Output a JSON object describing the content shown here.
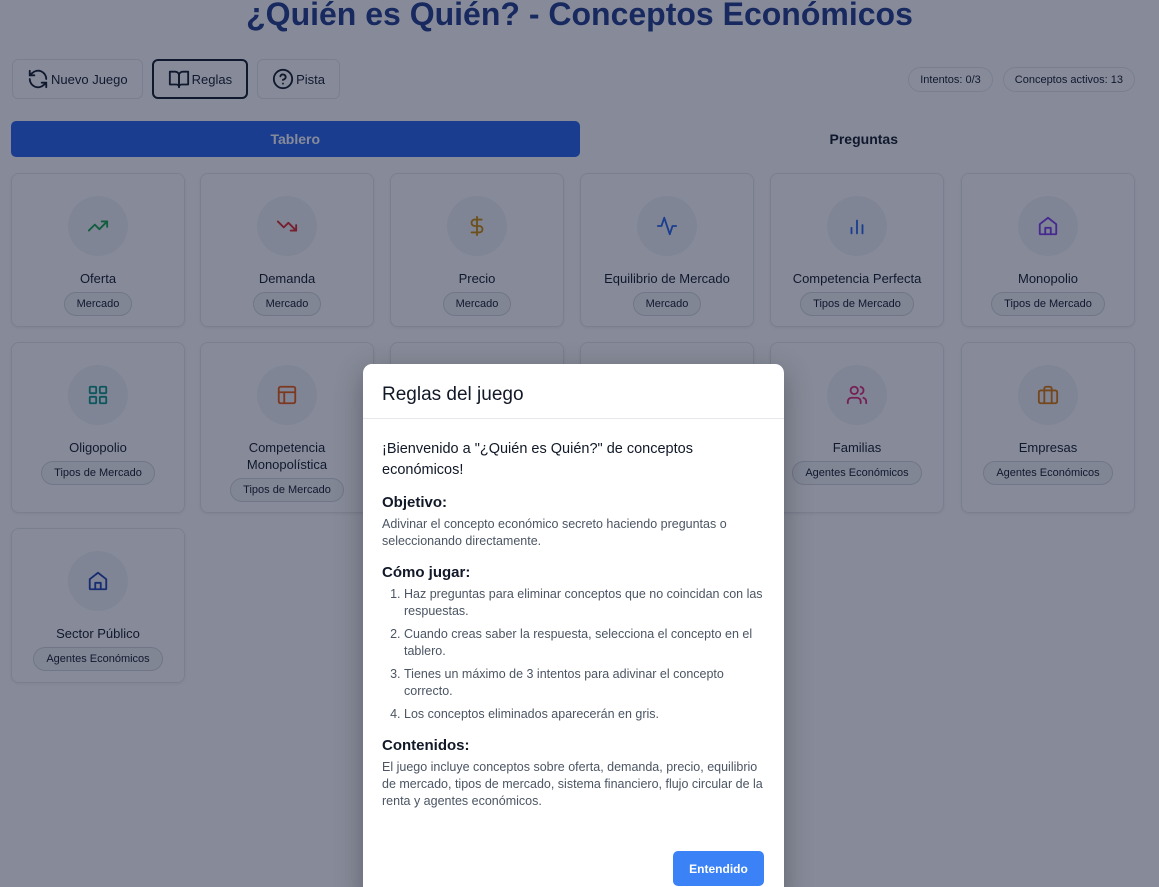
{
  "title": "¿Quién es Quién? - Conceptos Económicos",
  "toolbar": {
    "new_game": "Nuevo Juego",
    "rules": "Reglas",
    "hint": "Pista"
  },
  "stats": {
    "attempts": "Intentos: 0/3",
    "active": "Conceptos activos: 13"
  },
  "tabs": {
    "board": "Tablero",
    "questions": "Preguntas"
  },
  "cards": [
    {
      "name": "Oferta",
      "tag": "Mercado",
      "icon": "trending-up-icon",
      "color": "#16a34a"
    },
    {
      "name": "Demanda",
      "tag": "Mercado",
      "icon": "trending-down-icon",
      "color": "#dc2626"
    },
    {
      "name": "Precio",
      "tag": "Mercado",
      "icon": "dollar-icon",
      "color": "#ca8a04"
    },
    {
      "name": "Equilibrio de Mercado",
      "tag": "Mercado",
      "icon": "activity-icon",
      "color": "#2563eb"
    },
    {
      "name": "Competencia Perfecta",
      "tag": "Tipos de Mercado",
      "icon": "bar-chart-icon",
      "color": "#2563eb"
    },
    {
      "name": "Monopolio",
      "tag": "Tipos de Mercado",
      "icon": "home-icon",
      "color": "#7c3aed"
    },
    {
      "name": "Oligopolio",
      "tag": "Tipos de Mercado",
      "icon": "grid-icon",
      "color": "#0d9488"
    },
    {
      "name": "Competencia Monopolística",
      "tag": "Tipos de Mercado",
      "icon": "layout-icon",
      "color": "#ea580c"
    },
    {
      "name": "Familias",
      "tag": "Agentes Económicos",
      "icon": "users-icon",
      "color": "#db2777"
    },
    {
      "name": "Empresas",
      "tag": "Agentes Económicos",
      "icon": "briefcase-icon",
      "color": "#d97706"
    },
    {
      "name": "Sector Público",
      "tag": "Agentes Económicos",
      "icon": "home-icon",
      "color": "#1e40af"
    }
  ],
  "modal": {
    "title": "Reglas del juego",
    "intro": "¡Bienvenido a \"¿Quién es Quién?\" de conceptos económicos!",
    "objective_heading": "Objetivo:",
    "objective_text": "Adivinar el concepto económico secreto haciendo preguntas o seleccionando directamente.",
    "howto_heading": "Cómo jugar:",
    "steps": [
      "Haz preguntas para eliminar conceptos que no coincidan con las respuestas.",
      "Cuando creas saber la respuesta, selecciona el concepto en el tablero.",
      "Tienes un máximo de 3 intentos para adivinar el concepto correcto.",
      "Los conceptos eliminados aparecerán en gris."
    ],
    "contents_heading": "Contenidos:",
    "contents_text": "El juego incluye conceptos sobre oferta, demanda, precio, equilibrio de mercado, tipos de mercado, sistema financiero, flujo circular de la renta y agentes económicos.",
    "ok_button": "Entendido"
  }
}
